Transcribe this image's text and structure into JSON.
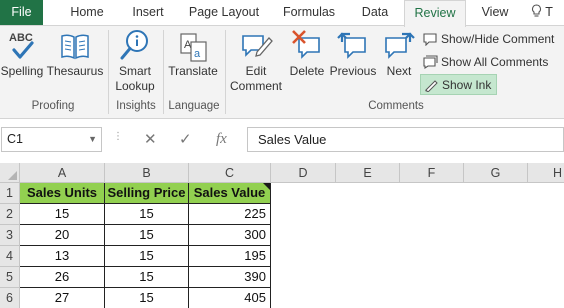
{
  "ribbon_tabs": [
    "File",
    "Home",
    "Insert",
    "Page Layout",
    "Formulas",
    "Data",
    "Review",
    "View",
    "T"
  ],
  "active_tab": "Review",
  "groups": {
    "proofing": {
      "label": "Proofing",
      "spelling": {
        "label": "Spelling",
        "icon_text": "ABC"
      },
      "thesaurus": {
        "label": "Thesaurus"
      }
    },
    "insights": {
      "label": "Insights",
      "smart_lookup": {
        "label_line1": "Smart",
        "label_line2": "Lookup"
      }
    },
    "language": {
      "label": "Language",
      "translate": {
        "label": "Translate"
      }
    },
    "comments": {
      "label": "Comments",
      "edit_comment": {
        "label_line1": "Edit",
        "label_line2": "Comment"
      },
      "delete": {
        "label": "Delete"
      },
      "previous": {
        "label": "Previous"
      },
      "next": {
        "label": "Next"
      },
      "show_hide_comment": {
        "label": "Show/Hide Comment"
      },
      "show_all_comments": {
        "label": "Show All Comments"
      },
      "show_ink": {
        "label": "Show Ink"
      }
    }
  },
  "formula_bar": {
    "name_box": "C1",
    "formula": "Sales Value",
    "fx_label": "fx"
  },
  "columns": [
    "A",
    "B",
    "C",
    "D",
    "E",
    "F",
    "G",
    "H"
  ],
  "rows": [
    "1",
    "2",
    "3",
    "4",
    "5",
    "6"
  ],
  "table": {
    "headers": [
      "Sales Units",
      "Selling Price",
      "Sales Value"
    ],
    "rows": [
      [
        "15",
        "15",
        "225"
      ],
      [
        "20",
        "15",
        "300"
      ],
      [
        "13",
        "15",
        "195"
      ],
      [
        "26",
        "15",
        "390"
      ],
      [
        "27",
        "15",
        "405"
      ]
    ]
  },
  "colors": {
    "file_tab": "#217346",
    "header_fill": "#92d050",
    "show_ink_highlight": "#c5e7cf"
  }
}
